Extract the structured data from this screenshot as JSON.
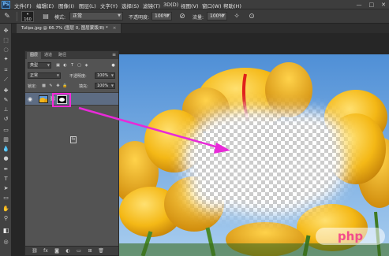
{
  "app": {
    "logo": "Ps"
  },
  "menu": {
    "items": [
      "文件(F)",
      "编辑(E)",
      "图像(I)",
      "图层(L)",
      "文字(Y)",
      "选择(S)",
      "滤镜(T)",
      "3D(D)",
      "视图(V)",
      "窗口(W)",
      "帮助(H)"
    ]
  },
  "window_controls": {
    "minimize": "—",
    "restore": "□",
    "close": "✕"
  },
  "options": {
    "brush_size": "160",
    "mode_label": "模式:",
    "mode_value": "正常",
    "opacity_label": "不透明度:",
    "opacity_value": "100%",
    "flow_label": "流量:",
    "flow_value": "100%"
  },
  "document": {
    "tab_title": "Tulips.jpg @ 66.7% (图层 0, 图层蒙版/8) *",
    "tab_close": "×"
  },
  "layers_panel": {
    "tabs": [
      "图层",
      "通道",
      "路径"
    ],
    "menu_icon": "≡",
    "filter_kind": "类型",
    "blend_mode": "正常",
    "opacity_label": "不透明度:",
    "opacity_value": "100%",
    "lock_label": "锁定:",
    "fill_label": "填充:",
    "fill_value": "100%",
    "layer_fx": "fx"
  },
  "watermark": {
    "text": "php"
  },
  "colors": {
    "highlight": "#ff2ad9",
    "arrow": "#e82ad8",
    "panel_bg": "#535353",
    "selected_layer": "#5d6c83"
  },
  "icons": {
    "tools": [
      "move-tool-icon",
      "marquee-tool-icon",
      "lasso-tool-icon",
      "quick-select-tool-icon",
      "crop-tool-icon",
      "eyedropper-tool-icon",
      "healing-brush-tool-icon",
      "brush-tool-icon",
      "clone-stamp-tool-icon",
      "history-brush-tool-icon",
      "eraser-tool-icon",
      "gradient-tool-icon",
      "blur-tool-icon",
      "dodge-tool-icon",
      "pen-tool-icon",
      "type-tool-icon",
      "path-select-tool-icon",
      "shape-tool-icon",
      "hand-tool-icon",
      "zoom-tool-icon"
    ]
  }
}
